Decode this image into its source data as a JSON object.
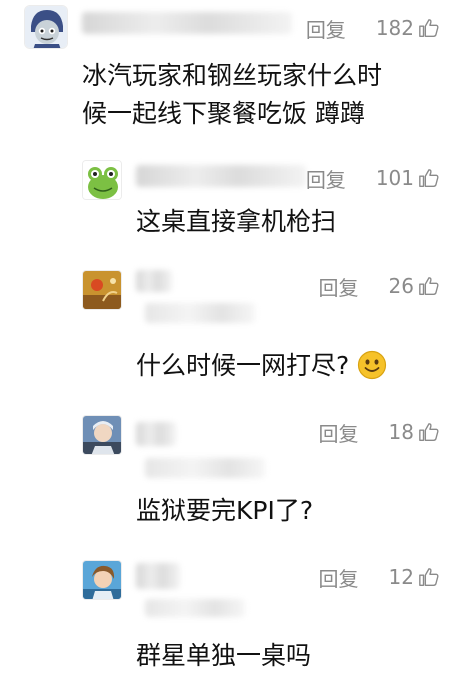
{
  "reply_label": "回复",
  "comments": [
    {
      "likes": "182",
      "lines": [
        "冰汽玩家和钢丝玩家什么时",
        "候一起线下聚餐吃饭 蹲蹲"
      ]
    },
    {
      "likes": "101",
      "lines": [
        "这桌直接拿机枪扫"
      ]
    },
    {
      "likes": "26",
      "lines": [
        "什么时候一网打尽?"
      ]
    },
    {
      "likes": "18",
      "lines": [
        "监狱要完KPI了?"
      ]
    },
    {
      "likes": "12",
      "lines": [
        "群星单独一桌吗"
      ]
    }
  ],
  "icons": {
    "like": "thumb-up-icon",
    "emoji": "smiling-face-emoji"
  },
  "colors": {
    "text": "#111111",
    "meta": "#8a8a8a",
    "emoji": "#f6c22a"
  }
}
